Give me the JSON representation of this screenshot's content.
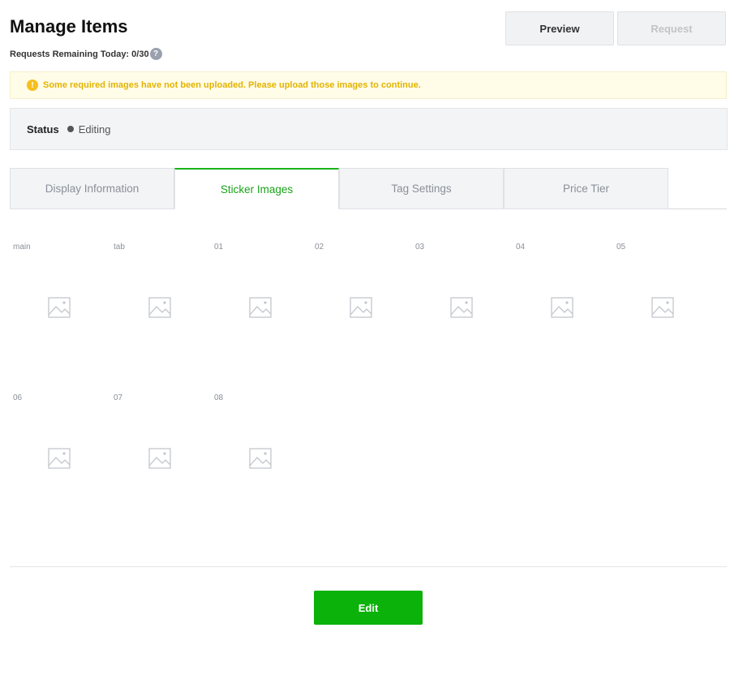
{
  "header": {
    "title": "Manage Items",
    "requests_remaining": "Requests Remaining Today: 0/30",
    "help_symbol": "?",
    "preview_label": "Preview",
    "request_label": "Request"
  },
  "warning": {
    "icon_symbol": "!",
    "text": "Some required images have not been uploaded. Please upload those images to continue."
  },
  "status": {
    "label": "Status",
    "value": "Editing"
  },
  "tabs": [
    {
      "label": "Display Information",
      "active": false
    },
    {
      "label": "Sticker Images",
      "active": true
    },
    {
      "label": "Tag Settings",
      "active": false
    },
    {
      "label": "Price Tier",
      "active": false
    }
  ],
  "image_slots": [
    {
      "label": "main",
      "icon": "image-placeholder-icon"
    },
    {
      "label": "tab",
      "icon": "image-placeholder-icon"
    },
    {
      "label": "01",
      "icon": "image-placeholder-icon"
    },
    {
      "label": "02",
      "icon": "image-placeholder-icon"
    },
    {
      "label": "03",
      "icon": "image-placeholder-icon"
    },
    {
      "label": "04",
      "icon": "image-placeholder-icon"
    },
    {
      "label": "05",
      "icon": "image-placeholder-icon"
    },
    {
      "label": "06",
      "icon": "image-placeholder-icon"
    },
    {
      "label": "07",
      "icon": "image-placeholder-icon"
    },
    {
      "label": "08",
      "icon": "image-placeholder-icon"
    }
  ],
  "footer": {
    "edit_label": "Edit"
  },
  "colors": {
    "accent_green": "#0ab20a",
    "warning_text": "#e2b400",
    "warning_bg": "#fffce8"
  }
}
